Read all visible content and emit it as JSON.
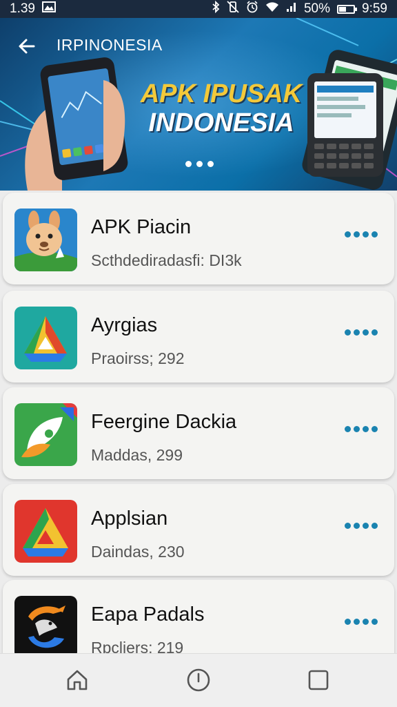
{
  "status_bar": {
    "time_left": "1.39",
    "battery_percent": "50%",
    "battery_level": 0.5,
    "time_right": "9:59"
  },
  "app_bar": {
    "title": "IRPINONESIA"
  },
  "banner": {
    "headline_line1": "APK IPUSAK",
    "headline_line2": "INDONESIA",
    "page_indicator_count": 3
  },
  "apps": [
    {
      "name": "APK Piacin",
      "meta": "Scthdediradasfi: DI3k",
      "icon": "kangaroo-mascot-icon"
    },
    {
      "name": "Ayrgias",
      "meta": "Praoirss; 292",
      "icon": "drive-triangle-teal-icon"
    },
    {
      "name": "Feergine Dackia",
      "meta": "Maddas, 299",
      "icon": "green-leaf-app-icon"
    },
    {
      "name": "Applsian",
      "meta": "Daindas, 230",
      "icon": "drive-triangle-red-icon"
    },
    {
      "name": "Eapa Padals",
      "meta": "Rpcliers; 219",
      "icon": "dolphin-swirl-icon"
    }
  ],
  "colors": {
    "accent": "#1a83b0",
    "status_bar": "#1b2a3e",
    "headline_yellow": "#f3c93a"
  }
}
